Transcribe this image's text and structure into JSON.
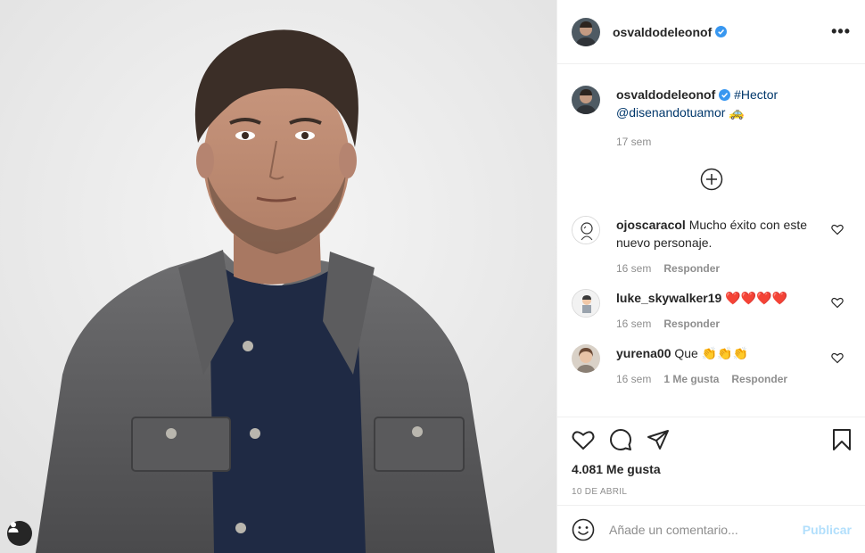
{
  "post": {
    "username": "osvaldodeleonof",
    "more_label": "•••",
    "photo_icon": "user-tag-icon"
  },
  "caption": {
    "username": "osvaldodeleonof",
    "hashtag": "#Hector",
    "mention": "@disenandotuamor",
    "emoji": "🚕",
    "time": "17 sem"
  },
  "comments": [
    {
      "username": "ojoscaracol",
      "text_line1": "Mucho éxito con este",
      "text_line2": "nuevo personaje.",
      "time": "16 sem",
      "reply_label": "Responder"
    },
    {
      "username": "luke_skywalker19",
      "text": "❤️❤️❤️❤️",
      "time": "16 sem",
      "reply_label": "Responder"
    },
    {
      "username": "yurena00",
      "text": "Que 👏👏👏",
      "time": "16 sem",
      "likes": "1 Me gusta",
      "reply_label": "Responder"
    }
  ],
  "actions": {
    "likes": "4.081 Me gusta",
    "date": "10 DE ABRIL"
  },
  "composer": {
    "placeholder": "Añade un comentario...",
    "publish_label": "Publicar"
  },
  "colors": {
    "verified": "#3897f0",
    "link": "#00376b",
    "publish_disabled": "#b2dffc"
  }
}
